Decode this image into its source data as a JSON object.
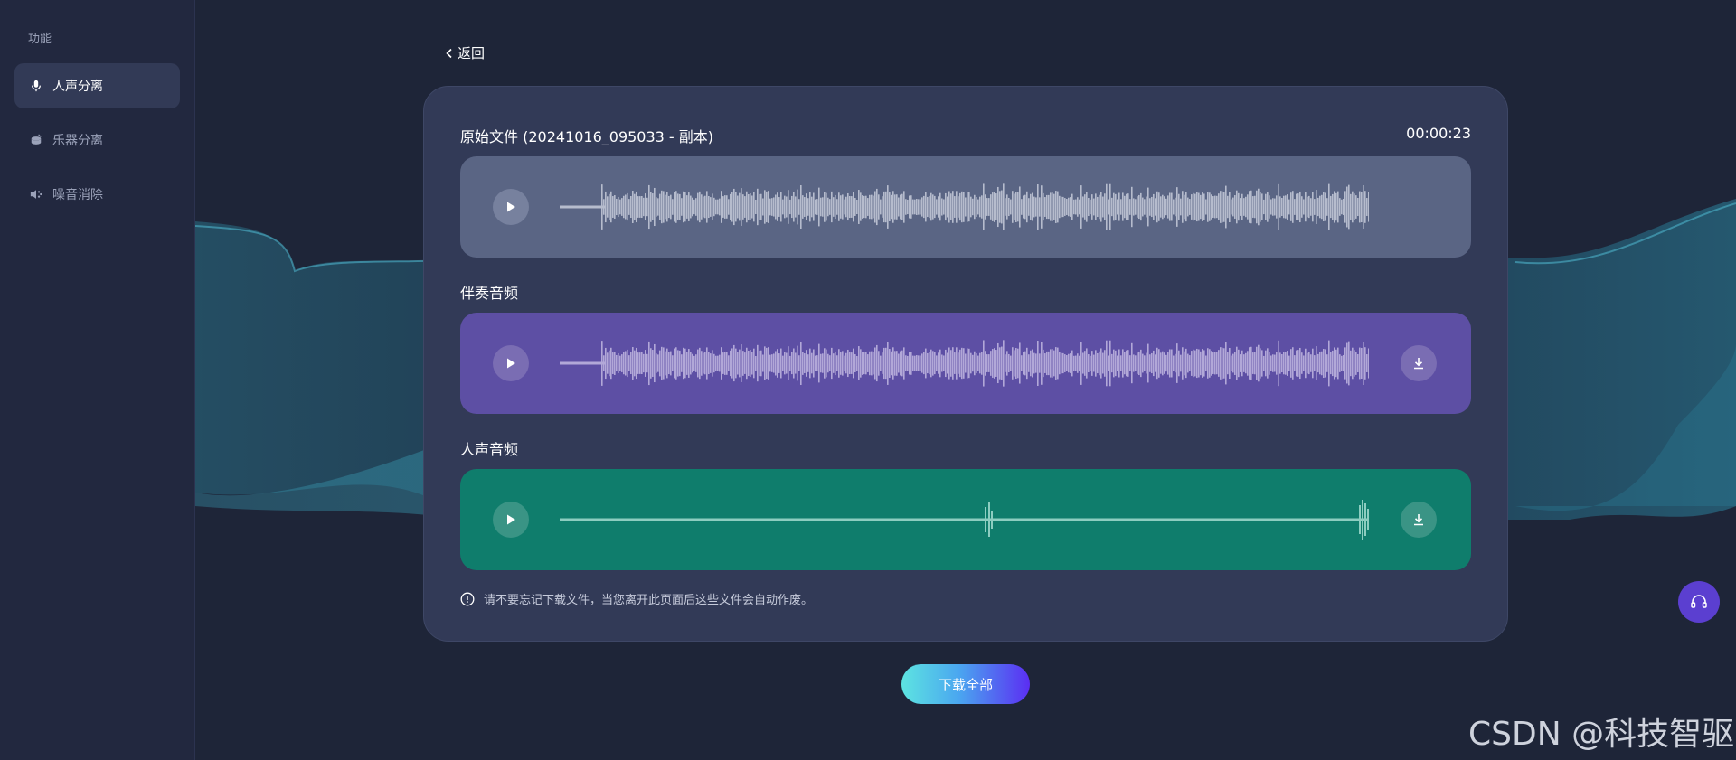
{
  "sidebar": {
    "title": "功能",
    "items": [
      {
        "label": "人声分离",
        "icon": "microphone-icon",
        "active": true
      },
      {
        "label": "乐器分离",
        "icon": "drum-icon",
        "active": false
      },
      {
        "label": "噪音消除",
        "icon": "speaker-noise-icon",
        "active": false
      }
    ]
  },
  "back": {
    "label": "返回"
  },
  "card": {
    "original": {
      "label": "原始文件 (20241016_095033 - 副本)",
      "duration": "00:00:23"
    },
    "accompaniment": {
      "label": "伴奏音频"
    },
    "vocals": {
      "label": "人声音频"
    },
    "note": "请不要忘记下载文件，当您离开此页面后这些文件会自动作废。"
  },
  "download_all": {
    "label": "下载全部"
  },
  "watermark": "CSDN @科技智驱",
  "colors": {
    "original_track": "#5a6584",
    "accompaniment_track": "#5d4fa4",
    "vocals_track": "#0f7d6c",
    "accent_gradient_start": "#5de4e1",
    "accent_gradient_end": "#5b2ef2",
    "support_button": "#5b3fd0"
  }
}
